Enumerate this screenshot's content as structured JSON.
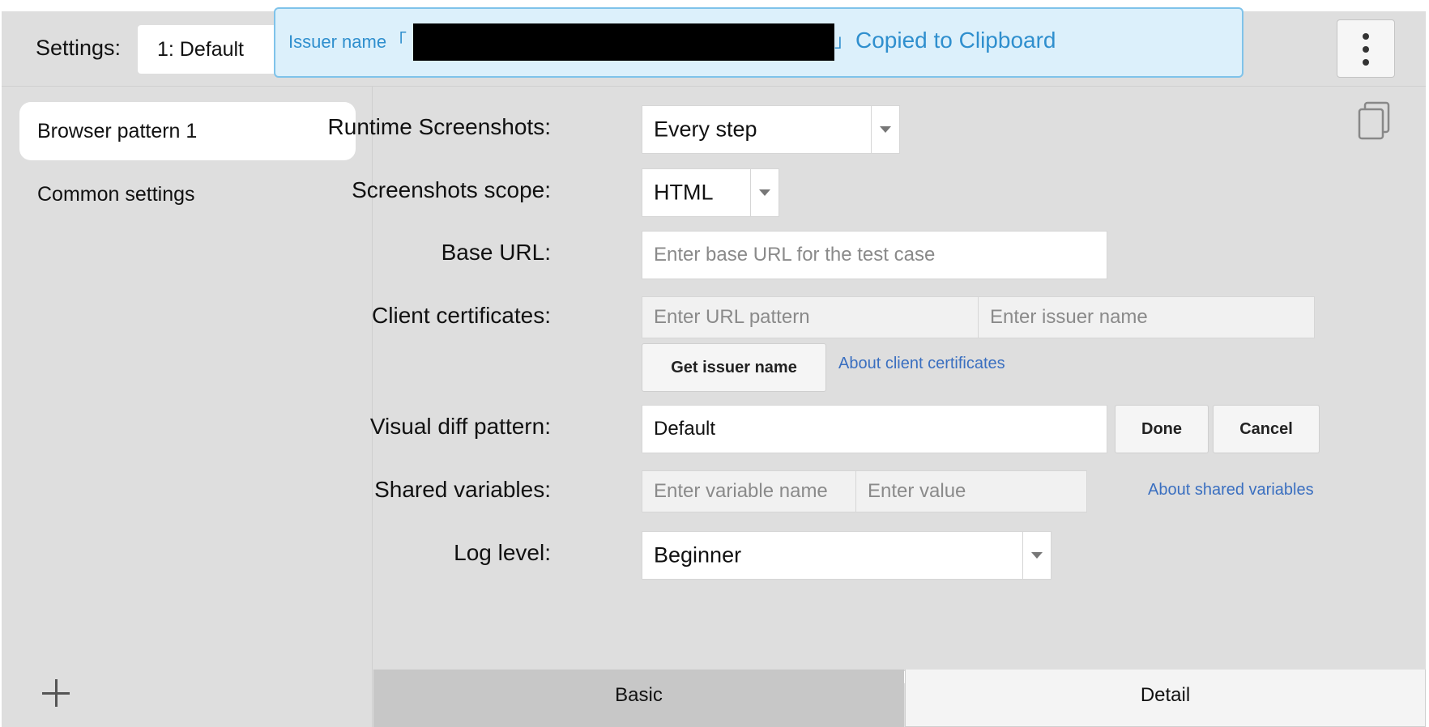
{
  "header": {
    "settings_label": "Settings:",
    "settings_value": "1: Default",
    "more_menu_icon": "vertical-ellipsis-icon"
  },
  "toast": {
    "label": "Issuer name",
    "open_bracket": "「",
    "close_bracket": "」",
    "message": "Copied to Clipboard"
  },
  "sidebar": {
    "items": [
      {
        "label": "Browser pattern 1",
        "active": true
      },
      {
        "label": "Common settings",
        "active": false
      }
    ],
    "add_icon": "plus-icon"
  },
  "form": {
    "runtime_screenshots": {
      "label": "Runtime Screenshots:",
      "value": "Every step"
    },
    "screenshots_scope": {
      "label": "Screenshots scope:",
      "value": "HTML"
    },
    "base_url": {
      "label": "Base URL:",
      "value": "",
      "placeholder": "Enter base URL for the test case"
    },
    "client_certificates": {
      "label": "Client certificates:",
      "url_placeholder": "Enter URL pattern",
      "issuer_placeholder": "Enter issuer name",
      "get_issuer_button": "Get issuer name",
      "about_link": "About client certificates"
    },
    "visual_diff_pattern": {
      "label": "Visual diff pattern:",
      "value": "Default",
      "done_button": "Done",
      "cancel_button": "Cancel"
    },
    "shared_variables": {
      "label": "Shared variables:",
      "name_placeholder": "Enter variable name",
      "value_placeholder": "Enter value",
      "about_link": "About shared variables"
    },
    "log_level": {
      "label": "Log level:",
      "value": "Beginner"
    },
    "copy_icon": "copy-icon"
  },
  "tabs": [
    {
      "label": "Basic",
      "active": true
    },
    {
      "label": "Detail",
      "active": false
    }
  ]
}
